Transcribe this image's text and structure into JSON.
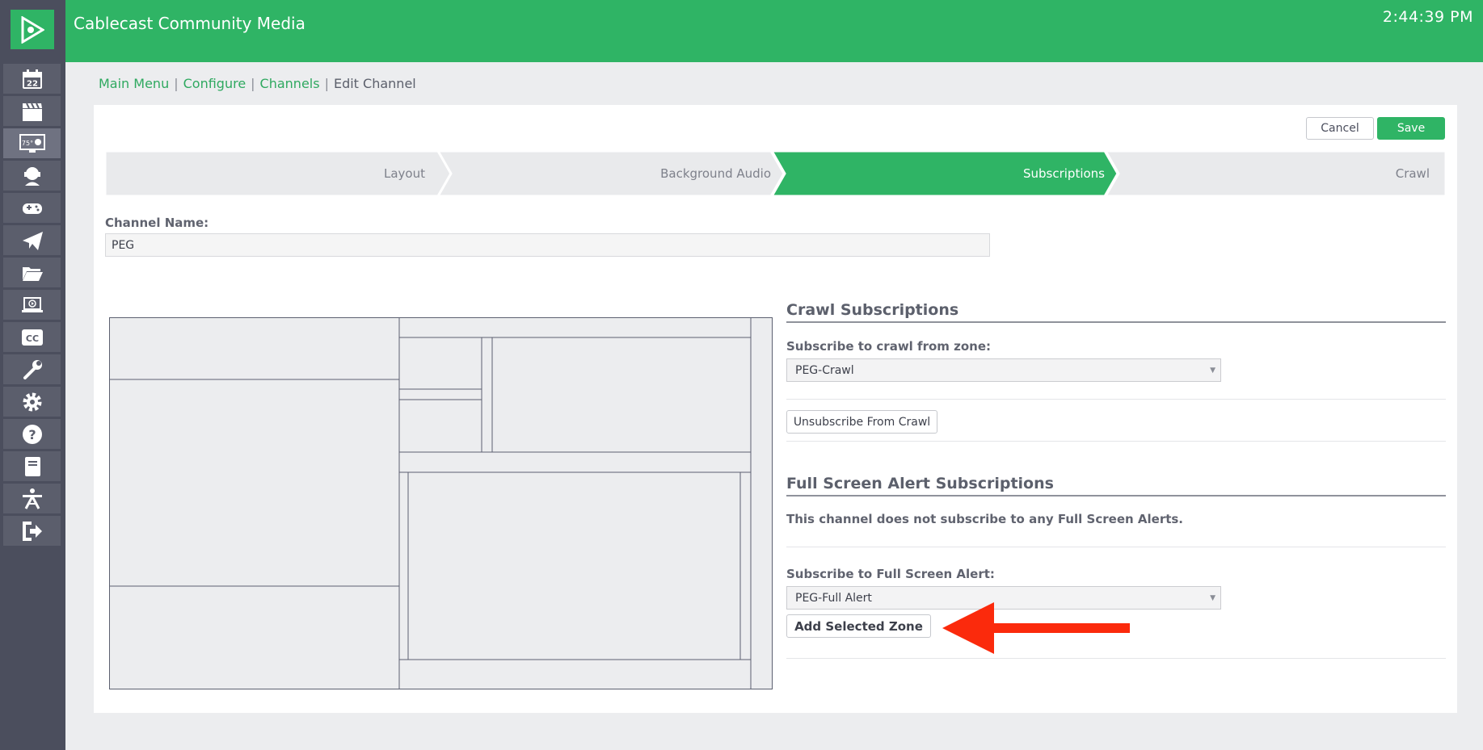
{
  "app": {
    "title": "Cablecast Community Media",
    "clock": "2:44:39 PM"
  },
  "sidebar": {
    "items": [
      {
        "icon": "calendar-icon",
        "label": "22"
      },
      {
        "icon": "clapperboard-icon"
      },
      {
        "icon": "weather-monitor-icon",
        "label": "75°"
      },
      {
        "icon": "headset-icon"
      },
      {
        "icon": "gamepad-icon"
      },
      {
        "icon": "paper-plane-icon"
      },
      {
        "icon": "folder-open-icon"
      },
      {
        "icon": "laptop-play-icon"
      },
      {
        "icon": "closed-caption-icon",
        "label": "CC"
      },
      {
        "icon": "wrench-icon"
      },
      {
        "icon": "gear-icon"
      },
      {
        "icon": "question-icon"
      },
      {
        "icon": "book-icon"
      },
      {
        "icon": "antenna-icon"
      },
      {
        "icon": "sign-out-icon"
      }
    ],
    "active_index": 2
  },
  "breadcrumb": {
    "main_menu": "Main Menu",
    "configure": "Configure",
    "channels": "Channels",
    "current": "Edit Channel",
    "separator": "|"
  },
  "actions": {
    "cancel": "Cancel",
    "save": "Save"
  },
  "steps": [
    {
      "label": "Layout",
      "active": false
    },
    {
      "label": "Background Audio",
      "active": false
    },
    {
      "label": "Subscriptions",
      "active": true
    },
    {
      "label": "Crawl",
      "active": false
    }
  ],
  "channel": {
    "name_label": "Channel Name:",
    "name_value": "PEG"
  },
  "crawl": {
    "title": "Crawl Subscriptions",
    "zone_label": "Subscribe to crawl from zone:",
    "zone_selected": "PEG-Crawl",
    "unsubscribe_label": "Unsubscribe From Crawl"
  },
  "alerts": {
    "title": "Full Screen Alert Subscriptions",
    "none_text": "This channel does not subscribe to any Full Screen Alerts.",
    "subscribe_label": "Subscribe to Full Screen Alert:",
    "alert_selected": "PEG-Full Alert",
    "add_label": "Add Selected Zone"
  },
  "colors": {
    "brand": "#2fb465",
    "sidebar": "#4b4e5d",
    "annotation_arrow": "#fb2a0c"
  }
}
